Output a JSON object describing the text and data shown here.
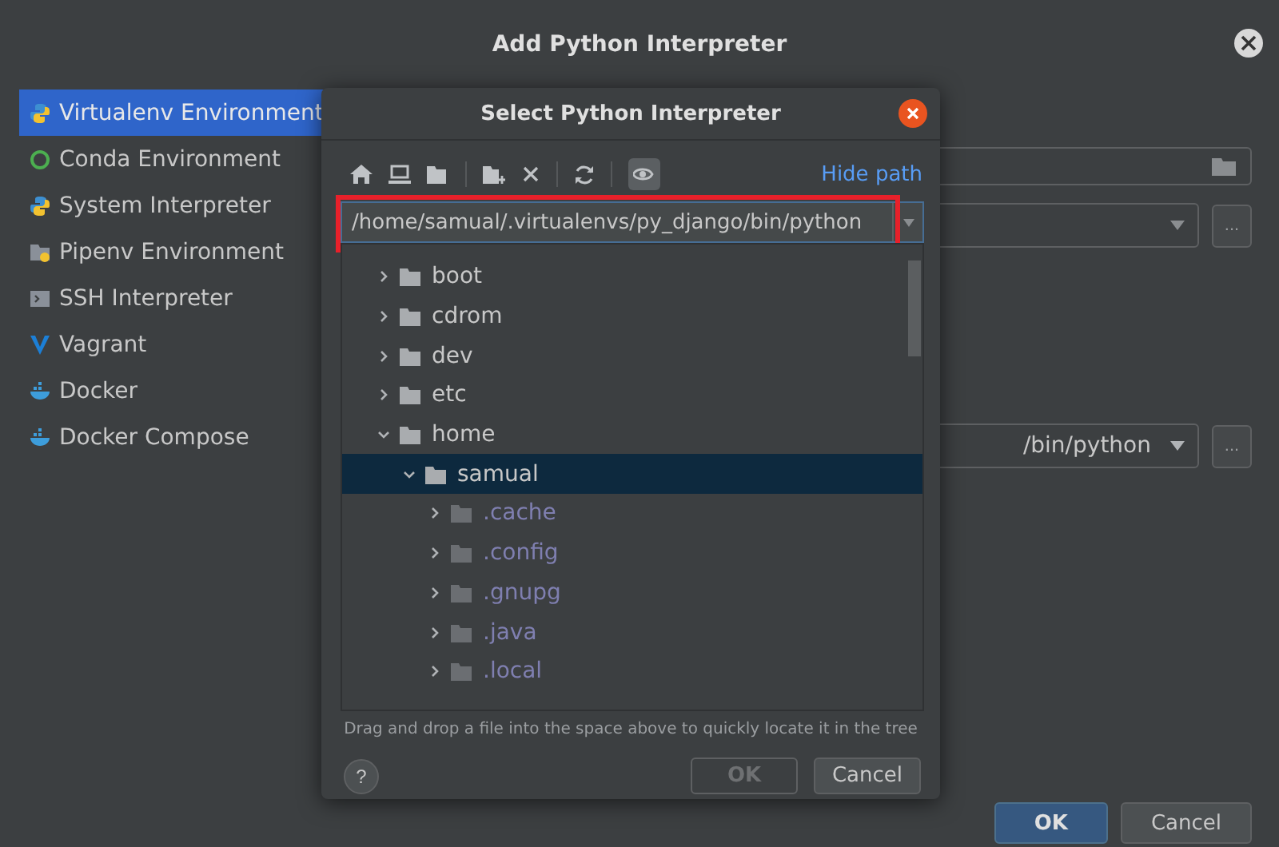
{
  "window": {
    "title": "Add Python Interpreter"
  },
  "sidebar": {
    "items": [
      {
        "label": "Virtualenv Environment",
        "kind": "python",
        "selected": true
      },
      {
        "label": "Conda Environment",
        "kind": "ring",
        "selected": false
      },
      {
        "label": "System Interpreter",
        "kind": "python",
        "selected": false
      },
      {
        "label": "Pipenv Environment",
        "kind": "folder",
        "selected": false
      },
      {
        "label": "SSH Interpreter",
        "kind": "terminal",
        "selected": false
      },
      {
        "label": "Vagrant",
        "kind": "v",
        "selected": false
      },
      {
        "label": "Docker",
        "kind": "whale",
        "selected": false
      },
      {
        "label": "Docker Compose",
        "kind": "whale",
        "selected": false
      }
    ]
  },
  "form": {
    "browse_buttons": [
      "...",
      "..."
    ],
    "interpreter_value": "/bin/python"
  },
  "buttons": [
    {
      "label": "OK",
      "primary": true
    },
    {
      "label": "Cancel",
      "primary": false
    }
  ],
  "dialog": {
    "title": "Select Python Interpreter",
    "hide_path_link": "Hide path",
    "path": "/home/samual/.virtualenvs/py_django/bin/python",
    "show_hidden_on": true,
    "tree": [
      {
        "name": "boot",
        "expanded": false,
        "hidden": false,
        "selected": false
      },
      {
        "name": "cdrom",
        "expanded": false,
        "hidden": false,
        "selected": false
      },
      {
        "name": "dev",
        "expanded": false,
        "hidden": false,
        "selected": false
      },
      {
        "name": "etc",
        "expanded": false,
        "hidden": false,
        "selected": false
      },
      {
        "name": "home",
        "expanded": true,
        "hidden": false,
        "selected": false,
        "children": [
          {
            "name": "samual",
            "expanded": true,
            "hidden": false,
            "selected": true,
            "children": [
              {
                "name": ".cache",
                "expanded": false,
                "hidden": true,
                "selected": false
              },
              {
                "name": ".config",
                "expanded": false,
                "hidden": true,
                "selected": false
              },
              {
                "name": ".gnupg",
                "expanded": false,
                "hidden": true,
                "selected": false
              },
              {
                "name": ".java",
                "expanded": false,
                "hidden": true,
                "selected": false
              },
              {
                "name": ".local",
                "expanded": false,
                "hidden": true,
                "selected": false
              }
            ]
          }
        ]
      }
    ],
    "hint": "Drag and drop a file into the space above to quickly locate it in the tree",
    "help_button": "?",
    "buttons": [
      {
        "label": "OK",
        "disabled": true
      },
      {
        "label": "Cancel",
        "disabled": false
      }
    ]
  }
}
